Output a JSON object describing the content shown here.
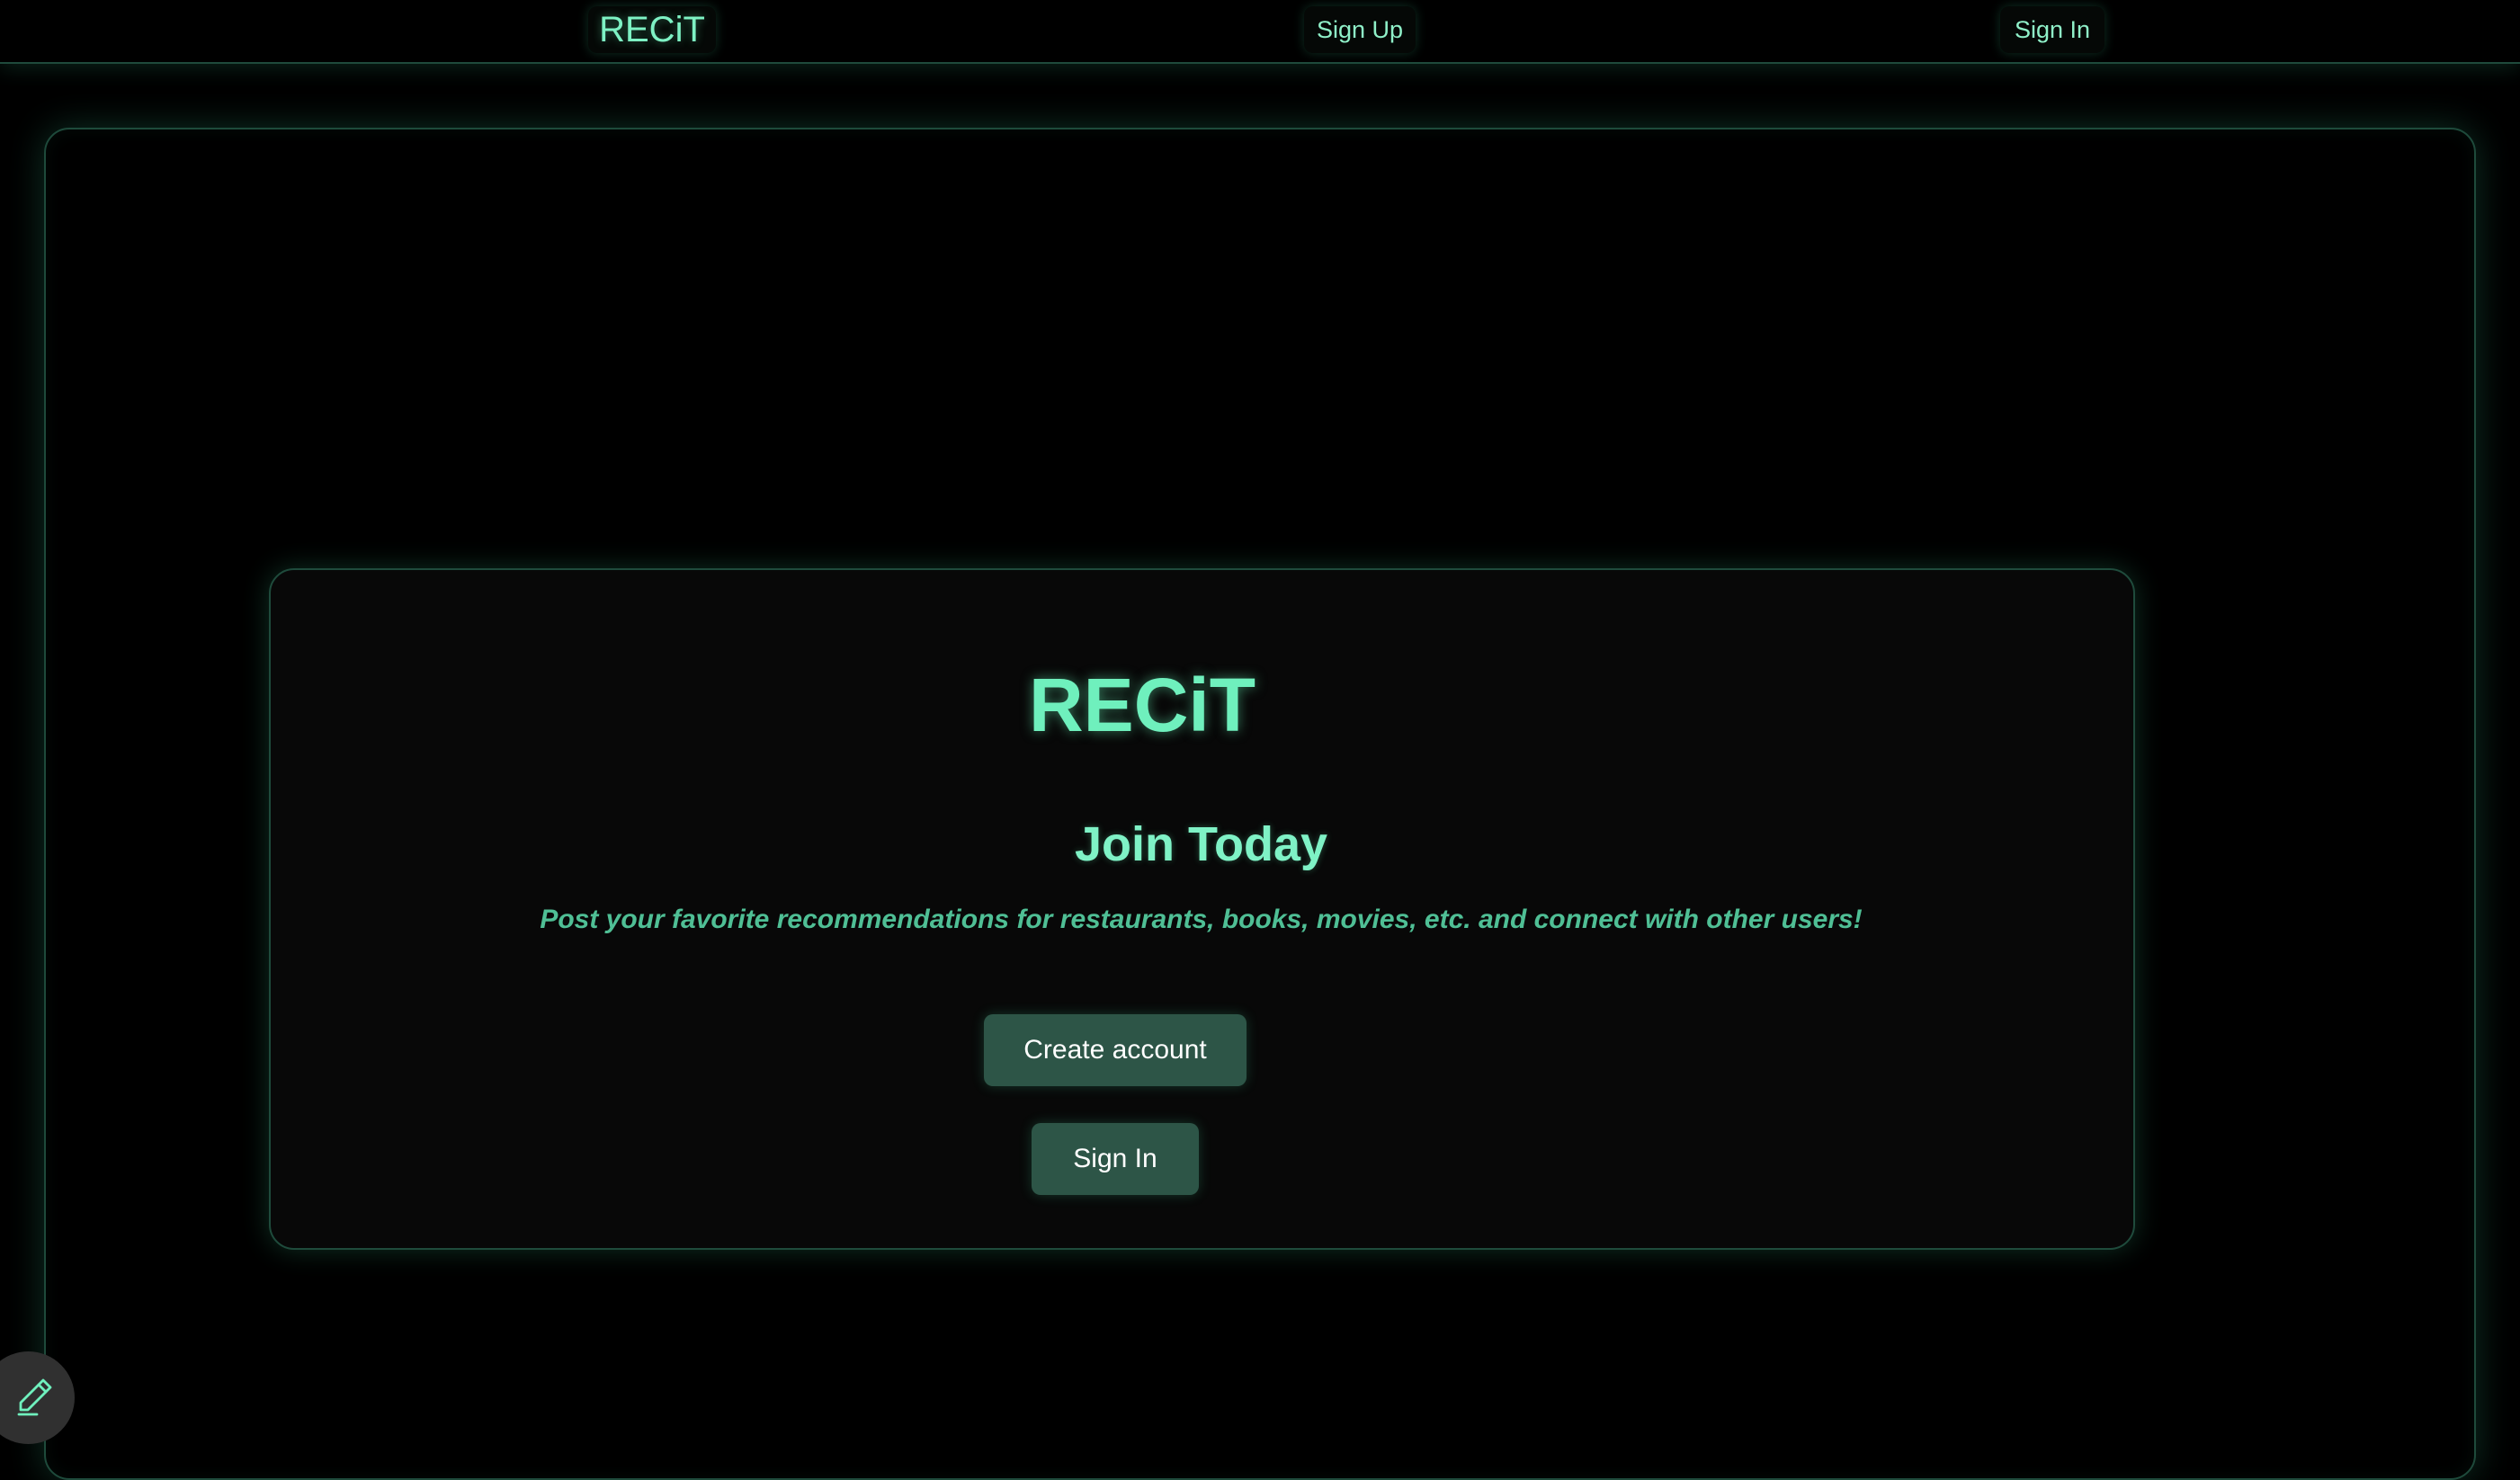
{
  "nav": {
    "logo": "RECiT",
    "sign_up": "Sign Up",
    "sign_in": "Sign In"
  },
  "card": {
    "logo": "RECiT",
    "heading": "Join Today",
    "tagline": "Post your favorite recommendations for restaurants, books, movies, etc. and connect with other users!",
    "create_account_label": "Create account",
    "sign_in_label": "Sign In"
  },
  "icons": {
    "fab": "pencil-icon"
  },
  "colors": {
    "accent": "#7ef2c4",
    "tagline": "#4fbf95",
    "button_bg": "#2d5547",
    "background": "#000000",
    "card_bg": "#080808"
  }
}
